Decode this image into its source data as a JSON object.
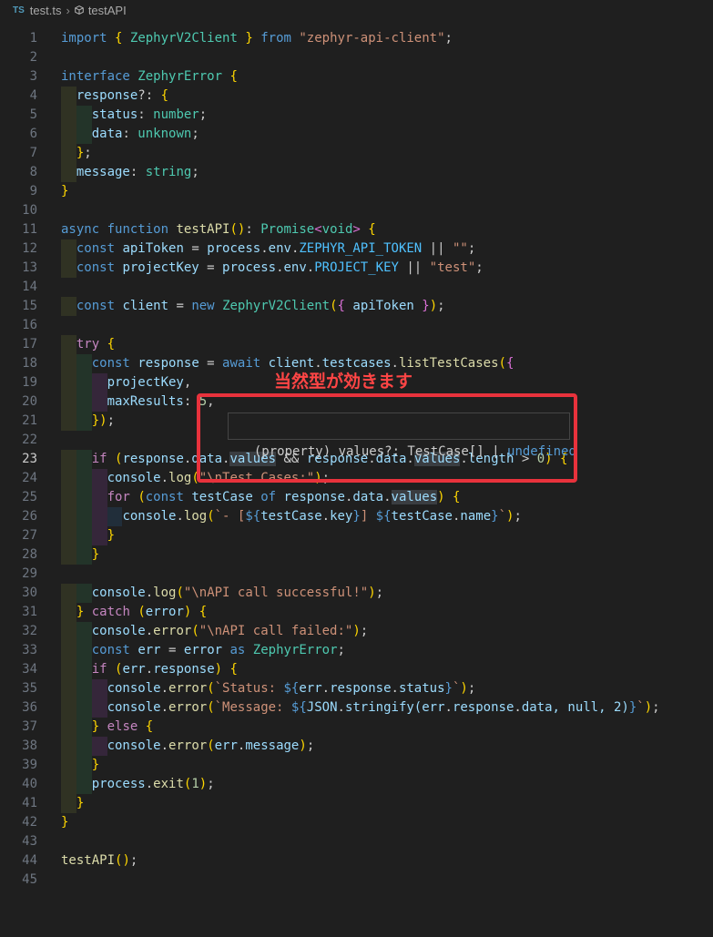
{
  "breadcrumb": {
    "file_icon": "TS",
    "file_name": "test.ts",
    "separator": "›",
    "symbol_icon": "symbol-cube-icon",
    "symbol_name": "testAPI"
  },
  "editor": {
    "active_line": 23,
    "line_numbers": [
      "1",
      "2",
      "3",
      "4",
      "5",
      "6",
      "7",
      "8",
      "9",
      "10",
      "11",
      "12",
      "13",
      "14",
      "15",
      "16",
      "17",
      "18",
      "19",
      "20",
      "21",
      "22",
      "23",
      "24",
      "25",
      "26",
      "27",
      "28",
      "29",
      "30",
      "31",
      "32",
      "33",
      "34",
      "35",
      "36",
      "37",
      "38",
      "39",
      "40",
      "41",
      "42",
      "43",
      "44",
      "45"
    ],
    "lines": [
      "import { ZephyrV2Client } from \"zephyr-api-client\";",
      "",
      "interface ZephyrError {",
      "  response?: {",
      "    status: number;",
      "    data: unknown;",
      "  };",
      "  message: string;",
      "}",
      "",
      "async function testAPI(): Promise<void> {",
      "  const apiToken = process.env.ZEPHYR_API_TOKEN || \"\";",
      "  const projectKey = process.env.PROJECT_KEY || \"test\";",
      "",
      "  const client = new ZephyrV2Client({ apiToken });",
      "",
      "  try {",
      "    const response = await client.testcases.listTestCases({",
      "      projectKey,",
      "      maxResults: 5,",
      "    });",
      "",
      "    if (response.data.values && response.data.values.length > 0) {",
      "      console.log(\"\\nTest Cases:\");",
      "      for (const testCase of response.data.values) {",
      "        console.log(`- [${testCase.key}] ${testCase.name}`);",
      "      }",
      "    }",
      "",
      "    console.log(\"\\nAPI call successful!\");",
      "  } catch (error) {",
      "    console.error(\"\\nAPI call failed:\");",
      "    const err = error as ZephyrError;",
      "    if (err.response) {",
      "      console.error(`Status: ${err.response.status}`);",
      "      console.error(`Message: ${JSON.stringify(err.response.data, null, 2)}`);",
      "    } else {",
      "      console.error(err.message);",
      "    }",
      "    process.exit(1);",
      "  }",
      "}",
      "",
      "testAPI();",
      ""
    ]
  },
  "hover": {
    "prefix": "(property) values?: TestCase[] | ",
    "undefined_label": "undefined"
  },
  "annotation": {
    "text": "当然型が効きます",
    "color": "#e8323c"
  }
}
